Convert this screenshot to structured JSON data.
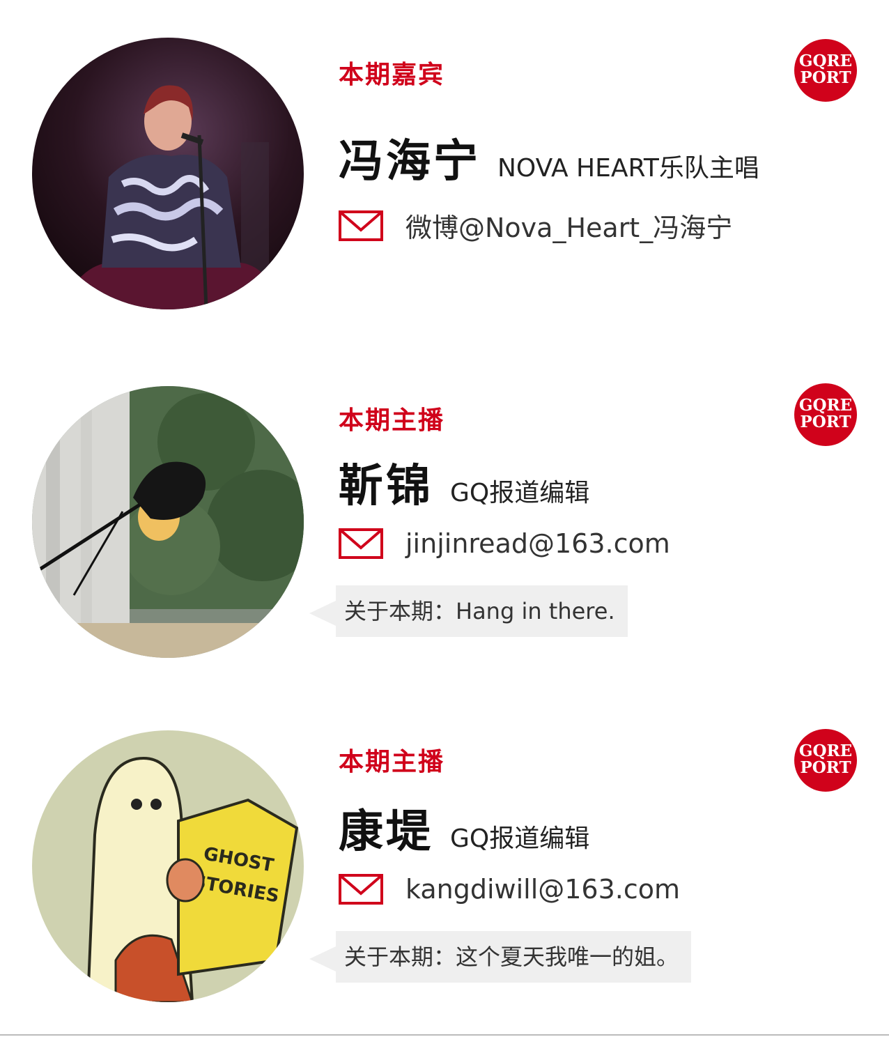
{
  "colors": {
    "accent": "#d0021b",
    "note_bg": "#efefef"
  },
  "logo": {
    "line1": "GQRE",
    "line2": "PORT"
  },
  "cards": [
    {
      "role": "本期嘉宾",
      "name": "冯海宁",
      "title": "NOVA HEART乐队主唱",
      "contact": "微博@Nova_Heart_冯海宁",
      "contact_icon": "mail-icon"
    },
    {
      "role": "本期主播",
      "name": "靳锦",
      "title": "GQ报道编辑",
      "contact": "jinjinread@163.com",
      "contact_icon": "mail-icon",
      "note": "关于本期：Hang in there."
    },
    {
      "role": "本期主播",
      "name": "康堤",
      "title": "GQ报道编辑",
      "contact": "kangdiwill@163.com",
      "contact_icon": "mail-icon",
      "note": "关于本期：这个夏天我唯一的姐。",
      "avatar_text": [
        "GHOST",
        "STORIES"
      ]
    }
  ]
}
